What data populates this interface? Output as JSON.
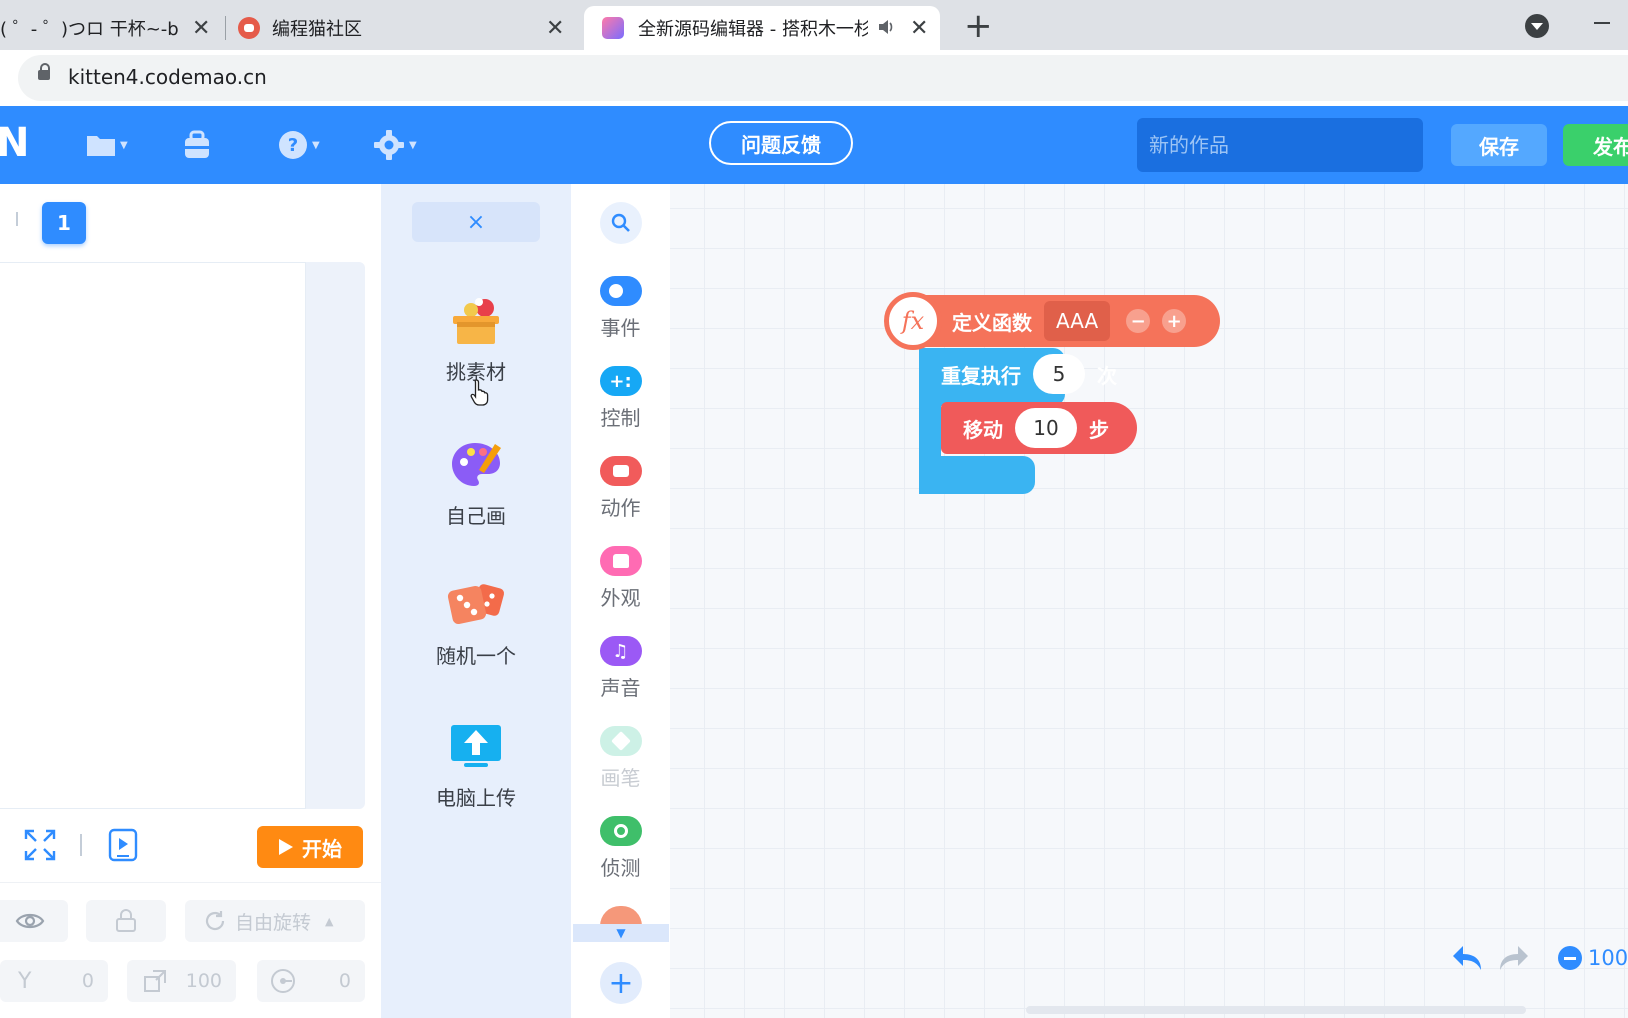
{
  "browser": {
    "tabs": [
      {
        "title": "( ゜- ゜)つロ 干杯~-bilil",
        "active": false
      },
      {
        "title": "编程猫社区",
        "active": false
      },
      {
        "title": "全新源码编辑器 - 搭积木一杉",
        "active": true
      }
    ],
    "new_tab": "+",
    "close_glyph": "✕",
    "url": "kitten4.codemao.cn"
  },
  "header": {
    "logo_char": "N",
    "menu_icons": [
      "folder-icon",
      "backpack-icon",
      "help-icon",
      "settings-icon"
    ],
    "feedback_label": "问题反馈",
    "work_title_placeholder": "新的作品",
    "save_label": "保存",
    "publish_label": "发布",
    "accent_color": "#2f8cff"
  },
  "stage": {
    "page_number": "1",
    "start_label": "开始",
    "rotation_mode": "自由旋转",
    "y_label": "Y",
    "y_value": "0",
    "scale_value": "100",
    "rotation_value": "0"
  },
  "materials": {
    "close_glyph": "×",
    "items": [
      {
        "label": "挑素材",
        "icon": "material-box-icon"
      },
      {
        "label": "自己画",
        "icon": "paint-palette-icon"
      },
      {
        "label": "随机一个",
        "icon": "dice-icon"
      },
      {
        "label": "电脑上传",
        "icon": "upload-icon"
      }
    ]
  },
  "categories": [
    {
      "label": "事件",
      "color": "#2f8cff"
    },
    {
      "label": "控制",
      "color": "#16a8f5"
    },
    {
      "label": "动作",
      "color": "#f15b5b"
    },
    {
      "label": "外观",
      "color": "#ff6bb3"
    },
    {
      "label": "声音",
      "color": "#9b59f5"
    },
    {
      "label": "画笔",
      "color": "#7ddfc2"
    },
    {
      "label": "侦测",
      "color": "#3fbf6a"
    }
  ],
  "blocks": {
    "define_label": "定义函数",
    "function_name": "AAA",
    "fx_glyph": "fx",
    "minus_glyph": "−",
    "plus_glyph": "+",
    "repeat_label": "重复执行",
    "repeat_count": "5",
    "repeat_unit": "次",
    "move_label": "移动",
    "move_steps": "10",
    "move_unit": "步"
  },
  "workspace": {
    "zoom_value": "100"
  }
}
